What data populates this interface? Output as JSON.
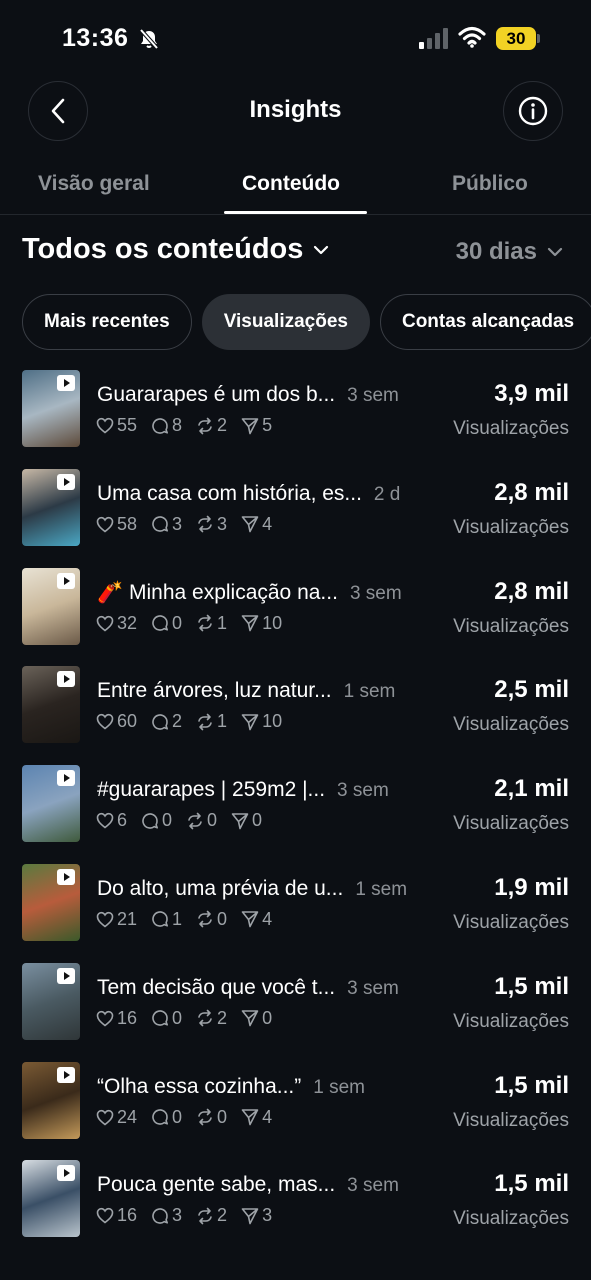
{
  "status_bar": {
    "time": "13:36",
    "battery": "30"
  },
  "header": {
    "title": "Insights"
  },
  "tabs": [
    {
      "label": "Visão geral"
    },
    {
      "label": "Conteúdo"
    },
    {
      "label": "Público"
    }
  ],
  "filters": {
    "content_type": "Todos os conteúdos",
    "period": "30 dias"
  },
  "chips": [
    {
      "label": "Mais recentes"
    },
    {
      "label": "Visualizações"
    },
    {
      "label": "Contas alcançadas"
    }
  ],
  "posts": [
    {
      "caption": "Guararapes é um dos b...",
      "ago": "3 sem",
      "likes": "55",
      "comments": "8",
      "reposts": "2",
      "shares": "5",
      "count": "3,9 mil",
      "count_label": "Visualizações",
      "thumb_colors": [
        "#4f6f86",
        "#a8b7c2",
        "#5d4a3a"
      ]
    },
    {
      "caption": "Uma casa com história, es...",
      "ago": "2 d",
      "likes": "58",
      "comments": "3",
      "reposts": "3",
      "shares": "4",
      "count": "2,8 mil",
      "count_label": "Visualizações",
      "thumb_colors": [
        "#c7b8a6",
        "#2c3a46",
        "#4aa7c4"
      ]
    },
    {
      "caption": "🧨 Minha explicação na...",
      "ago": "3 sem",
      "likes": "32",
      "comments": "0",
      "reposts": "1",
      "shares": "10",
      "count": "2,8 mil",
      "count_label": "Visualizações",
      "thumb_colors": [
        "#e8e2d4",
        "#c9b79a",
        "#6b5a48"
      ]
    },
    {
      "caption": "Entre árvores, luz natur...",
      "ago": "1 sem",
      "likes": "60",
      "comments": "2",
      "reposts": "1",
      "shares": "10",
      "count": "2,5 mil",
      "count_label": "Visualizações",
      "thumb_colors": [
        "#6a6259",
        "#2a2420",
        "#1a1714"
      ]
    },
    {
      "caption": "#guararapes | 259m2 |...",
      "ago": "3 sem",
      "likes": "6",
      "comments": "0",
      "reposts": "0",
      "shares": "0",
      "count": "2,1 mil",
      "count_label": "Visualizações",
      "thumb_colors": [
        "#5c84b1",
        "#8aa3bf",
        "#3f5a3c"
      ]
    },
    {
      "caption": "Do alto, uma prévia de u...",
      "ago": "1 sem",
      "likes": "21",
      "comments": "1",
      "reposts": "0",
      "shares": "4",
      "count": "1,9 mil",
      "count_label": "Visualizações",
      "thumb_colors": [
        "#5a7a3f",
        "#b85c3c",
        "#3b5a2a"
      ]
    },
    {
      "caption": "Tem decisão que você t...",
      "ago": "3 sem",
      "likes": "16",
      "comments": "0",
      "reposts": "2",
      "shares": "0",
      "count": "1,5 mil",
      "count_label": "Visualizações",
      "thumb_colors": [
        "#7a8fa0",
        "#4a5a62",
        "#2f3638"
      ]
    },
    {
      "caption": "“Olha essa cozinha...”",
      "ago": "1 sem",
      "likes": "24",
      "comments": "0",
      "reposts": "0",
      "shares": "4",
      "count": "1,5 mil",
      "count_label": "Visualizações",
      "thumb_colors": [
        "#7a5a34",
        "#3a2a1a",
        "#c49a5a"
      ]
    },
    {
      "caption": "Pouca gente sabe, mas...",
      "ago": "3 sem",
      "likes": "16",
      "comments": "3",
      "reposts": "2",
      "shares": "3",
      "count": "1,5 mil",
      "count_label": "Visualizações",
      "thumb_colors": [
        "#d7dde2",
        "#3a4f66",
        "#b9c4cc"
      ]
    }
  ]
}
